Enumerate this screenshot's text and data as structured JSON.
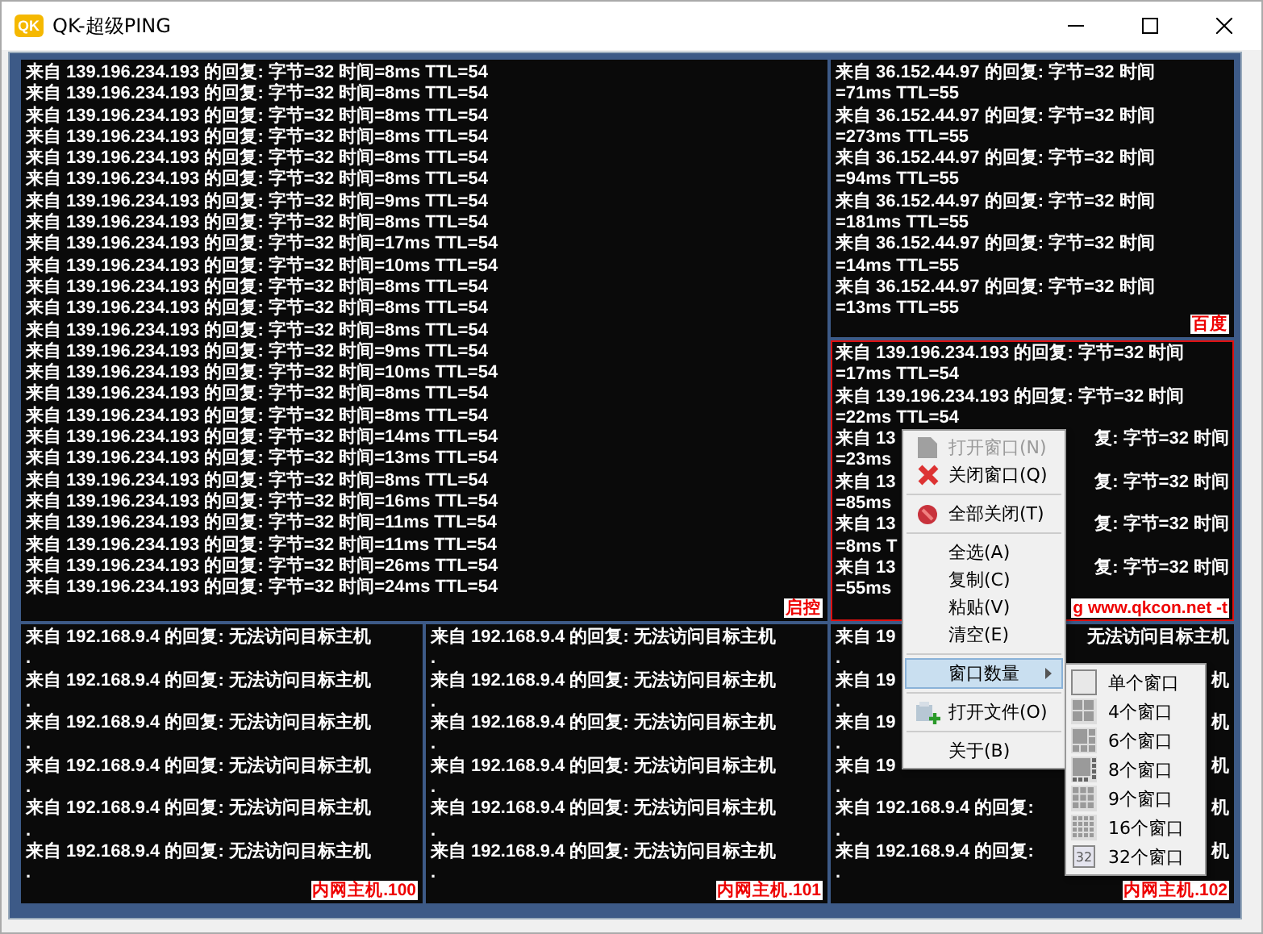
{
  "window": {
    "badge": "QK",
    "title": "QK-超级PING"
  },
  "panes": [
    {
      "label": "启控",
      "selected": false,
      "rows": [
        {
          "kind": "full",
          "text": "来自 139.196.234.193 的回复: 字节=32 时间=8ms TTL=54"
        },
        {
          "kind": "full",
          "text": "来自 139.196.234.193 的回复: 字节=32 时间=8ms TTL=54"
        },
        {
          "kind": "full",
          "text": "来自 139.196.234.193 的回复: 字节=32 时间=8ms TTL=54"
        },
        {
          "kind": "full",
          "text": "来自 139.196.234.193 的回复: 字节=32 时间=8ms TTL=54"
        },
        {
          "kind": "full",
          "text": "来自 139.196.234.193 的回复: 字节=32 时间=8ms TTL=54"
        },
        {
          "kind": "full",
          "text": "来自 139.196.234.193 的回复: 字节=32 时间=8ms TTL=54"
        },
        {
          "kind": "full",
          "text": "来自 139.196.234.193 的回复: 字节=32 时间=9ms TTL=54"
        },
        {
          "kind": "full",
          "text": "来自 139.196.234.193 的回复: 字节=32 时间=8ms TTL=54"
        },
        {
          "kind": "full",
          "text": "来自 139.196.234.193 的回复: 字节=32 时间=17ms TTL=54"
        },
        {
          "kind": "full",
          "text": "来自 139.196.234.193 的回复: 字节=32 时间=10ms TTL=54"
        },
        {
          "kind": "full",
          "text": "来自 139.196.234.193 的回复: 字节=32 时间=8ms TTL=54"
        },
        {
          "kind": "full",
          "text": "来自 139.196.234.193 的回复: 字节=32 时间=8ms TTL=54"
        },
        {
          "kind": "full",
          "text": "来自 139.196.234.193 的回复: 字节=32 时间=8ms TTL=54"
        },
        {
          "kind": "full",
          "text": "来自 139.196.234.193 的回复: 字节=32 时间=9ms TTL=54"
        },
        {
          "kind": "full",
          "text": "来自 139.196.234.193 的回复: 字节=32 时间=10ms TTL=54"
        },
        {
          "kind": "full",
          "text": "来自 139.196.234.193 的回复: 字节=32 时间=8ms TTL=54"
        },
        {
          "kind": "full",
          "text": "来自 139.196.234.193 的回复: 字节=32 时间=8ms TTL=54"
        },
        {
          "kind": "full",
          "text": "来自 139.196.234.193 的回复: 字节=32 时间=14ms TTL=54"
        },
        {
          "kind": "full",
          "text": "来自 139.196.234.193 的回复: 字节=32 时间=13ms TTL=54"
        },
        {
          "kind": "full",
          "text": "来自 139.196.234.193 的回复: 字节=32 时间=8ms TTL=54"
        },
        {
          "kind": "full",
          "text": "来自 139.196.234.193 的回复: 字节=32 时间=16ms TTL=54"
        },
        {
          "kind": "full",
          "text": "来自 139.196.234.193 的回复: 字节=32 时间=11ms TTL=54"
        },
        {
          "kind": "full",
          "text": "来自 139.196.234.193 的回复: 字节=32 时间=11ms TTL=54"
        },
        {
          "kind": "full",
          "text": "来自 139.196.234.193 的回复: 字节=32 时间=26ms TTL=54"
        },
        {
          "kind": "full",
          "text": "来自 139.196.234.193 的回复: 字节=32 时间=24ms TTL=54"
        }
      ]
    },
    {
      "label": "百度",
      "selected": false,
      "rows": [
        {
          "kind": "full",
          "text": "来自 36.152.44.97 的回复: 字节=32 时间"
        },
        {
          "kind": "full",
          "text": "=71ms TTL=55"
        },
        {
          "kind": "full",
          "text": "来自 36.152.44.97 的回复: 字节=32 时间"
        },
        {
          "kind": "full",
          "text": "=273ms TTL=55"
        },
        {
          "kind": "full",
          "text": "来自 36.152.44.97 的回复: 字节=32 时间"
        },
        {
          "kind": "full",
          "text": "=94ms TTL=55"
        },
        {
          "kind": "full",
          "text": "来自 36.152.44.97 的回复: 字节=32 时间"
        },
        {
          "kind": "full",
          "text": "=181ms TTL=55"
        },
        {
          "kind": "full",
          "text": "来自 36.152.44.97 的回复: 字节=32 时间"
        },
        {
          "kind": "full",
          "text": "=14ms TTL=55"
        },
        {
          "kind": "full",
          "text": "来自 36.152.44.97 的回复: 字节=32 时间"
        },
        {
          "kind": "full",
          "text": "=13ms TTL=55"
        }
      ]
    },
    {
      "label": "g www.qkcon.net -t",
      "selected": true,
      "rows": [
        {
          "kind": "full",
          "text": "来自 139.196.234.193 的回复: 字节=32 时间"
        },
        {
          "kind": "full",
          "text": "=17ms TTL=54"
        },
        {
          "kind": "full",
          "text": "来自 139.196.234.193 的回复: 字节=32 时间"
        },
        {
          "kind": "full",
          "text": "=22ms TTL=54"
        },
        {
          "kind": "split",
          "left": "来自 13",
          "right": "复: 字节=32 时间"
        },
        {
          "kind": "full",
          "text": "=23ms"
        },
        {
          "kind": "split",
          "left": "来自 13",
          "right": "复: 字节=32 时间"
        },
        {
          "kind": "full",
          "text": "=85ms"
        },
        {
          "kind": "split",
          "left": "来自 13",
          "right": "复: 字节=32 时间"
        },
        {
          "kind": "full",
          "text": "=8ms T"
        },
        {
          "kind": "split",
          "left": "来自 13",
          "right": "复: 字节=32 时间"
        },
        {
          "kind": "full",
          "text": "=55ms"
        }
      ]
    },
    {
      "label": "内网主机.100",
      "selected": false,
      "rows": [
        {
          "kind": "full",
          "text": "来自 192.168.9.4 的回复: 无法访问目标主机"
        },
        {
          "kind": "full",
          "text": "."
        },
        {
          "kind": "full",
          "text": "来自 192.168.9.4 的回复: 无法访问目标主机"
        },
        {
          "kind": "full",
          "text": "."
        },
        {
          "kind": "full",
          "text": "来自 192.168.9.4 的回复: 无法访问目标主机"
        },
        {
          "kind": "full",
          "text": "."
        },
        {
          "kind": "full",
          "text": "来自 192.168.9.4 的回复: 无法访问目标主机"
        },
        {
          "kind": "full",
          "text": "."
        },
        {
          "kind": "full",
          "text": "来自 192.168.9.4 的回复: 无法访问目标主机"
        },
        {
          "kind": "full",
          "text": "."
        },
        {
          "kind": "full",
          "text": "来自 192.168.9.4 的回复: 无法访问目标主机"
        },
        {
          "kind": "full",
          "text": "."
        }
      ]
    },
    {
      "label": "内网主机.101",
      "selected": false,
      "rows": [
        {
          "kind": "full",
          "text": "来自 192.168.9.4 的回复: 无法访问目标主机"
        },
        {
          "kind": "full",
          "text": "."
        },
        {
          "kind": "full",
          "text": "来自 192.168.9.4 的回复: 无法访问目标主机"
        },
        {
          "kind": "full",
          "text": "."
        },
        {
          "kind": "full",
          "text": "来自 192.168.9.4 的回复: 无法访问目标主机"
        },
        {
          "kind": "full",
          "text": "."
        },
        {
          "kind": "full",
          "text": "来自 192.168.9.4 的回复: 无法访问目标主机"
        },
        {
          "kind": "full",
          "text": "."
        },
        {
          "kind": "full",
          "text": "来自 192.168.9.4 的回复: 无法访问目标主机"
        },
        {
          "kind": "full",
          "text": "."
        },
        {
          "kind": "full",
          "text": "来自 192.168.9.4 的回复: 无法访问目标主机"
        },
        {
          "kind": "full",
          "text": "."
        }
      ]
    },
    {
      "label": "内网主机.102",
      "selected": false,
      "rows": [
        {
          "kind": "split",
          "left": "来自 19",
          "right": "无法访问目标主机"
        },
        {
          "kind": "full",
          "text": "."
        },
        {
          "kind": "split",
          "left": "来自 19",
          "right": "机"
        },
        {
          "kind": "full",
          "text": "."
        },
        {
          "kind": "split",
          "left": "来自 19",
          "right": "机"
        },
        {
          "kind": "full",
          "text": "."
        },
        {
          "kind": "split",
          "left": "来自 19",
          "right": "机"
        },
        {
          "kind": "full",
          "text": "."
        },
        {
          "kind": "split",
          "left": "来自 192.168.9.4 的回复:",
          "right": "机"
        },
        {
          "kind": "full",
          "text": "."
        },
        {
          "kind": "split",
          "left": "来自 192.168.9.4 的回复:",
          "right": "机"
        },
        {
          "kind": "full",
          "text": "."
        }
      ]
    }
  ],
  "context_menu": {
    "items": [
      {
        "kind": "item",
        "label": "打开窗口(N)",
        "disabled": true,
        "selected": false
      },
      {
        "kind": "item",
        "label": "关闭窗口(Q)",
        "disabled": false,
        "selected": false
      },
      {
        "kind": "separator"
      },
      {
        "kind": "item",
        "label": "全部关闭(T)",
        "disabled": false,
        "selected": false
      },
      {
        "kind": "separator"
      },
      {
        "kind": "item",
        "label": "全选(A)",
        "disabled": false,
        "selected": false
      },
      {
        "kind": "item",
        "label": "复制(C)",
        "disabled": false,
        "selected": false
      },
      {
        "kind": "item",
        "label": "粘贴(V)",
        "disabled": false,
        "selected": false
      },
      {
        "kind": "item",
        "label": "清空(E)",
        "disabled": false,
        "selected": false
      },
      {
        "kind": "separator"
      },
      {
        "kind": "submenu",
        "label": "窗口数量",
        "disabled": false,
        "selected": true
      },
      {
        "kind": "separator"
      },
      {
        "kind": "item",
        "label": "打开文件(O)",
        "disabled": false,
        "selected": false
      },
      {
        "kind": "separator"
      },
      {
        "kind": "item",
        "label": "关于(B)",
        "disabled": false,
        "selected": false
      }
    ]
  },
  "submenu": {
    "items": [
      {
        "label": "单个窗口"
      },
      {
        "label": "4个窗口"
      },
      {
        "label": "6个窗口"
      },
      {
        "label": "8个窗口"
      },
      {
        "label": "9个窗口"
      },
      {
        "label": "16个窗口"
      },
      {
        "icon_text": "32",
        "label": "32个窗口"
      }
    ]
  }
}
